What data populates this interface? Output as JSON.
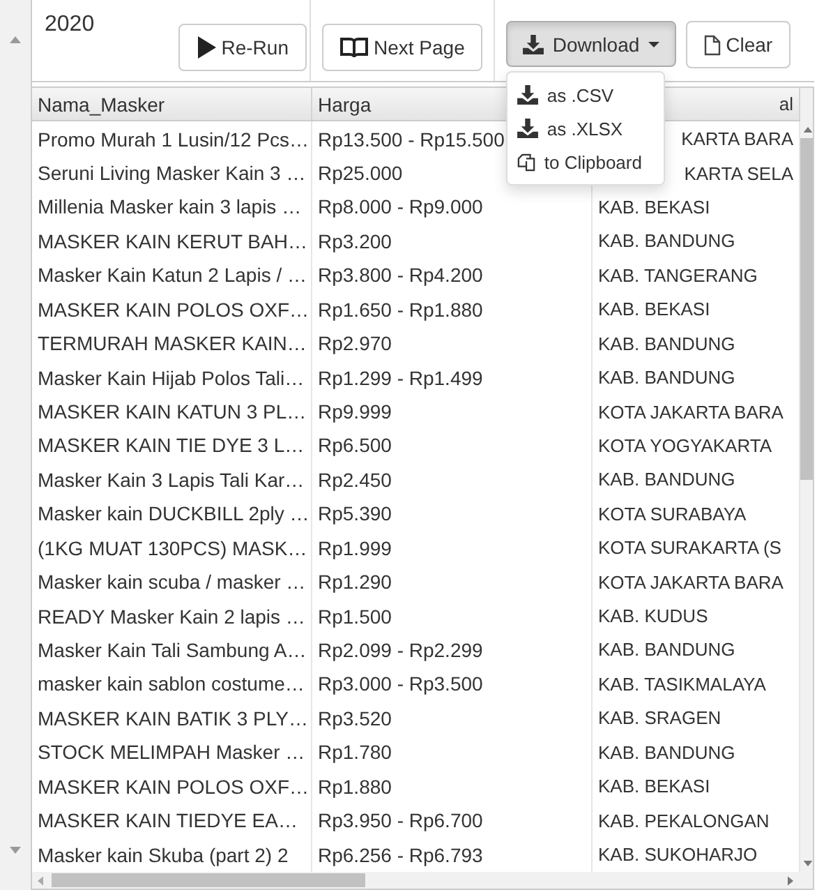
{
  "title": "2020",
  "toolbar": [
    {
      "kind": "rerun",
      "label": "Re-Run"
    },
    {
      "kind": "next",
      "label": "Next Page"
    }
  ],
  "download": {
    "label": "Download",
    "open": true,
    "items": [
      {
        "kind": "download",
        "label": "as .CSV"
      },
      {
        "kind": "download",
        "label": "as .XLSX"
      },
      {
        "kind": "copy",
        "label": "to Clipboard"
      }
    ]
  },
  "clear": {
    "label": "Clear"
  },
  "table": {
    "columns": [
      "Nama_Masker",
      "Harga",
      "al"
    ],
    "rows": [
      [
        "Promo Murah 1 Lusin/12 Pcs…",
        "Rp13.500 - Rp15.500",
        "KARTA BARA"
      ],
      [
        "Seruni Living Masker Kain 3 …",
        "Rp25.000",
        "KARTA SELA"
      ],
      [
        "Millenia Masker kain 3 lapis …",
        "Rp8.000 - Rp9.000",
        "KAB. BEKASI"
      ],
      [
        "MASKER KAIN KERUT BAH…",
        "Rp3.200",
        "KAB. BANDUNG"
      ],
      [
        "Masker Kain Katun 2 Lapis / …",
        "Rp3.800 - Rp4.200",
        "KAB. TANGERANG"
      ],
      [
        "MASKER KAIN POLOS OXF…",
        "Rp1.650 - Rp1.880",
        "KAB. BEKASI"
      ],
      [
        "TERMURAH MASKER KAIN…",
        "Rp2.970",
        "KAB. BANDUNG"
      ],
      [
        "Masker Kain Hijab Polos Tali…",
        "Rp1.299 - Rp1.499",
        "KAB. BANDUNG"
      ],
      [
        "MASKER KAIN KATUN 3 PL…",
        "Rp9.999",
        "KOTA JAKARTA BARA"
      ],
      [
        "MASKER KAIN TIE DYE 3 L…",
        "Rp6.500",
        "KOTA YOGYAKARTA"
      ],
      [
        "Masker Kain 3 Lapis Tali Kar…",
        "Rp2.450",
        "KAB. BANDUNG"
      ],
      [
        "Masker kain DUCKBILL 2ply …",
        "Rp5.390",
        "KOTA SURABAYA"
      ],
      [
        "(1KG MUAT 130PCS) MASK…",
        "Rp1.999",
        "KOTA SURAKARTA (S"
      ],
      [
        "Masker kain scuba / masker …",
        "Rp1.290",
        "KOTA JAKARTA BARA"
      ],
      [
        "READY Masker Kain 2 lapis …",
        "Rp1.500",
        "KAB. KUDUS"
      ],
      [
        "Masker Kain Tali Sambung A…",
        "Rp2.099 - Rp2.299",
        "KAB. BANDUNG"
      ],
      [
        "masker kain sablon costume…",
        "Rp3.000 - Rp3.500",
        "KAB. TASIKMALAYA"
      ],
      [
        "MASKER KAIN BATIK 3 PLY…",
        "Rp3.520",
        "KAB. SRAGEN"
      ],
      [
        "STOCK MELIMPAH Masker …",
        "Rp1.780",
        "KAB. BANDUNG"
      ],
      [
        "MASKER KAIN POLOS OXF…",
        "Rp1.880",
        "KAB. BEKASI"
      ],
      [
        "MASKER KAIN TIEDYE EA…",
        "Rp3.950 - Rp6.700",
        "KAB. PEKALONGAN"
      ],
      [
        "Masker kain Skuba (part 2) 2",
        "Rp6.256 - Rp6.793",
        "KAB. SUKOHARJO"
      ]
    ]
  }
}
